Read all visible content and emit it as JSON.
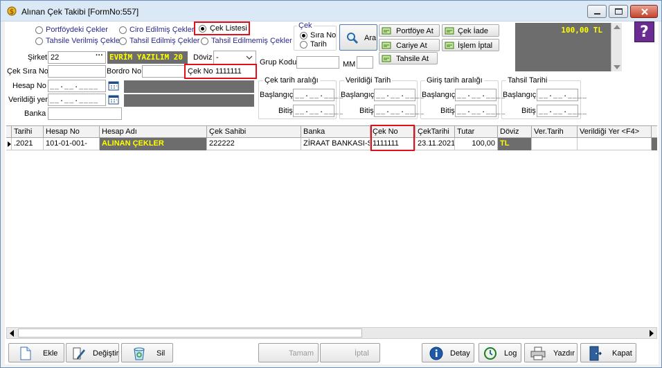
{
  "window": {
    "title": "Alınan Çek Takibi [FormNo:557]"
  },
  "filters": {
    "portfoydeki": "Portföydeki Çekler",
    "ciro": "Ciro Edilmiş Çekler",
    "cek_listesi": "Çek Listesi",
    "tahsile_verilmis": "Tahsile Verilmiş Çekler",
    "tahsil_edilmis": "Tahsil Edilmiş Çekler",
    "tahsil_edilmemis": "Tahsil Edilmemiş Çekler"
  },
  "cek_group": {
    "title": "Çek",
    "sira_no": "Sıra No",
    "tarih": "Tarih"
  },
  "search": {
    "label": "Ara"
  },
  "actions": {
    "portfoye_at": "Portföye At",
    "cek_iade": "Çek İade",
    "cariye_at": "Cariye At",
    "islem_iptal": "İşlem İptal",
    "tahsile_at": "Tahsile At"
  },
  "total": {
    "value": "100,00 TL"
  },
  "form": {
    "sirket_label": "Şirket",
    "sirket_value": "22",
    "sirket_name": "EVRİM YAZILIM 20",
    "doviz_label": "Döviz",
    "doviz_value": "-",
    "grup_kodu_label": "Grup Kodu",
    "mm_label": "MM",
    "cek_sira_no_label": "Çek Sıra No",
    "bordro_no_label": "Bordro No",
    "cek_no_label": "Çek No",
    "cek_no_value": "1111111",
    "hesap_no_label": "Hesap No",
    "verildigi_yer_label": "Verildiği yer",
    "banka_label": "Banka",
    "empty_date": "__.__.____"
  },
  "date_ranges": {
    "cek_tarih": "Çek tarih aralığı",
    "verildigi": "Verildiği Tarih",
    "giris": "Giriş tarih aralığı",
    "tahsil": "Tahsil Tarihi",
    "baslangic": "Başlangıç",
    "bitis": "Bitiş"
  },
  "grid": {
    "columns": [
      "Tarihi",
      "Hesap No",
      "Hesap Adı",
      "Çek Sahibi",
      "Banka",
      "Çek No",
      "ÇekTarihi",
      "Tutar",
      "Döviz",
      "Ver.Tarih",
      "Verildiği Yer <F4>"
    ],
    "row": {
      "tarihi": ".2021",
      "hesap_no": "101-01-001-",
      "hesap_adi": "ALINAN ÇEKLER",
      "cek_sahibi": "222222",
      "banka": "ZİRAAT BANKASI-S",
      "cek_no": "1111111",
      "cek_tarihi": "23.11.2021",
      "tutar": "100,00",
      "doviz": "TL",
      "ver_tarih": "",
      "verildigi_yer": ""
    }
  },
  "buttons": {
    "ekle": "Ekle",
    "degistir": "Değiştir",
    "sil": "Sil",
    "tamam": "Tamam",
    "iptal": "İptal",
    "detay": "Detay",
    "log": "Log",
    "yazdir": "Yazdır",
    "kapat": "Kapat"
  },
  "colors": {
    "accent_red": "#e0101a",
    "dark_panel": "#6d6d6d",
    "highlight_yellow": "#ffff00",
    "help_purple": "#6a2c91"
  }
}
